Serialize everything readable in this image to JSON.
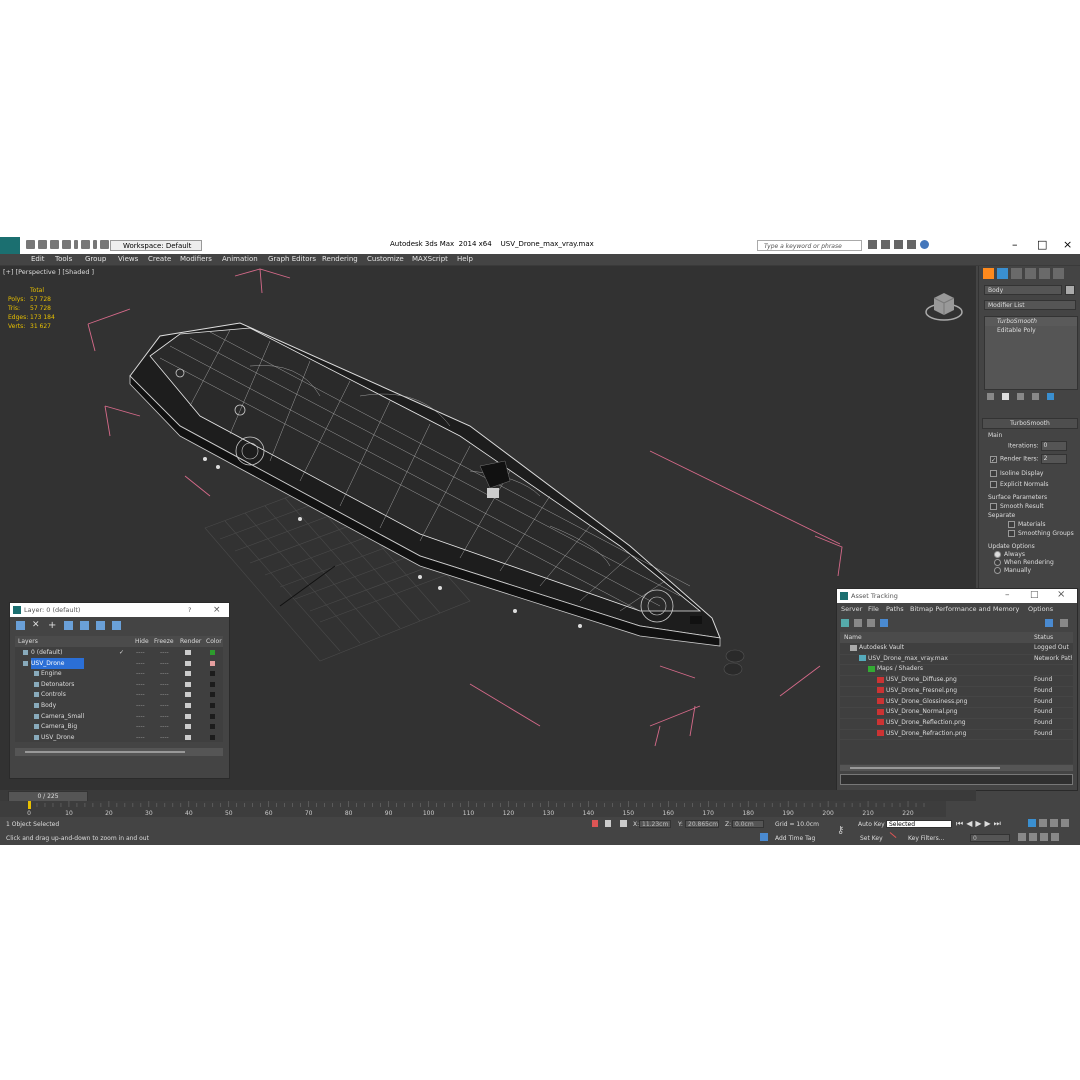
{
  "app": {
    "title": "Autodesk 3ds Max  2014 x64",
    "file": "USV_Drone_max_vray.max",
    "workspace": "Workspace: Default",
    "search_placeholder": "Type a keyword or phrase"
  },
  "menu": [
    "Edit",
    "Tools",
    "Group",
    "Views",
    "Create",
    "Modifiers",
    "Animation",
    "Graph Editors",
    "Rendering",
    "Customize",
    "MAXScript",
    "Help"
  ],
  "viewport": {
    "label": "[+] [Perspective ] [Shaded ]",
    "stats": {
      "header": "Total",
      "rows": [
        {
          "label": "Polys:",
          "value": "57 728"
        },
        {
          "label": "Tris:",
          "value": "57 728"
        },
        {
          "label": "Edges:",
          "value": "173 184"
        },
        {
          "label": "Verts:",
          "value": "31 627"
        }
      ]
    }
  },
  "command_panel": {
    "object_name": "Body",
    "modifier_list": "Modifier List",
    "stack": [
      "TurboSmooth",
      "Editable Poly"
    ],
    "rollout_title": "TurboSmooth",
    "main_label": "Main",
    "iterations_label": "Iterations:",
    "iterations_value": "0",
    "render_iters_label": "Render Iters:",
    "render_iters_value": "2",
    "isoline": "Isoline Display",
    "explicit": "Explicit Normals",
    "surface_params": "Surface Parameters",
    "smooth_result": "Smooth Result",
    "separate": "Separate",
    "materials": "Materials",
    "smoothing_groups": "Smoothing Groups",
    "update_options": "Update Options",
    "always": "Always",
    "when_rendering": "When Rendering",
    "manually": "Manually"
  },
  "layer_dialog": {
    "title": "Layer: 0 (default)",
    "help": "?",
    "close": "×",
    "columns": [
      "Layers",
      "Hide",
      "Freeze",
      "Render",
      "Color"
    ],
    "hide_mark": "----",
    "freeze_mark": "----",
    "rows": [
      {
        "name": "0 (default)",
        "indent": 0,
        "color": "#2d9b2d",
        "check": "✓"
      },
      {
        "name": "USV_Drone",
        "indent": 0,
        "color": "#e6a0a0",
        "selected": true
      },
      {
        "name": "Engine",
        "indent": 1,
        "color": "#1c1c1c"
      },
      {
        "name": "Detonators",
        "indent": 1,
        "color": "#1c1c1c"
      },
      {
        "name": "Controls",
        "indent": 1,
        "color": "#1c1c1c"
      },
      {
        "name": "Body",
        "indent": 1,
        "color": "#1c1c1c"
      },
      {
        "name": "Camera_Small",
        "indent": 1,
        "color": "#1c1c1c"
      },
      {
        "name": "Camera_Big",
        "indent": 1,
        "color": "#1c1c1c"
      },
      {
        "name": "USV_Drone",
        "indent": 1,
        "color": "#1c1c1c"
      }
    ]
  },
  "asset_dialog": {
    "title": "Asset Tracking",
    "menu": [
      "Server",
      "File",
      "Paths",
      "Bitmap Performance and Memory",
      "Options"
    ],
    "columns": [
      "Name",
      "Status"
    ],
    "rows": [
      {
        "name": "Autodesk Vault",
        "status": "Logged Out",
        "indent": 0,
        "type": "vault"
      },
      {
        "name": "USV_Drone_max_vray.max",
        "status": "Network Path",
        "indent": 1,
        "type": "max"
      },
      {
        "name": "Maps / Shaders",
        "status": "",
        "indent": 2,
        "type": "folder"
      },
      {
        "name": "USV_Drone_Diffuse.png",
        "status": "Found",
        "indent": 3,
        "type": "png"
      },
      {
        "name": "USV_Drone_Fresnel.png",
        "status": "Found",
        "indent": 3,
        "type": "png"
      },
      {
        "name": "USV_Drone_Glossiness.png",
        "status": "Found",
        "indent": 3,
        "type": "png"
      },
      {
        "name": "USV_Drone_Normal.png",
        "status": "Found",
        "indent": 3,
        "type": "png"
      },
      {
        "name": "USV_Drone_Reflection.png",
        "status": "Found",
        "indent": 3,
        "type": "png"
      },
      {
        "name": "USV_Drone_Refraction.png",
        "status": "Found",
        "indent": 3,
        "type": "png"
      }
    ]
  },
  "timeline": {
    "frame": "0 / 225",
    "ticks": [
      "0",
      "10",
      "20",
      "30",
      "40",
      "50",
      "60",
      "70",
      "80",
      "90",
      "100",
      "110",
      "120",
      "130",
      "140",
      "150",
      "160",
      "170",
      "180",
      "190",
      "200",
      "210",
      "220"
    ]
  },
  "status": {
    "selected": "1 Object Selected",
    "prompt": "Click and drag up-and-down to zoom in and out",
    "x_label": "X:",
    "x_value": "11.23cm",
    "y_label": "Y:",
    "y_value": "20.865cm",
    "z_label": "Z:",
    "z_value": "0.0cm",
    "grid": "Grid = 10.0cm",
    "add_time_tag": "Add Time Tag",
    "auto_key": "Auto Key",
    "set_key": "Set Key",
    "selected_dropdown": "Selected",
    "key_filters": "Key Filters...",
    "frame_field": "0"
  },
  "colors": {
    "bbox": "#d66a8a",
    "accent": "#ff8a1d",
    "selection": "#2b6fd6"
  }
}
